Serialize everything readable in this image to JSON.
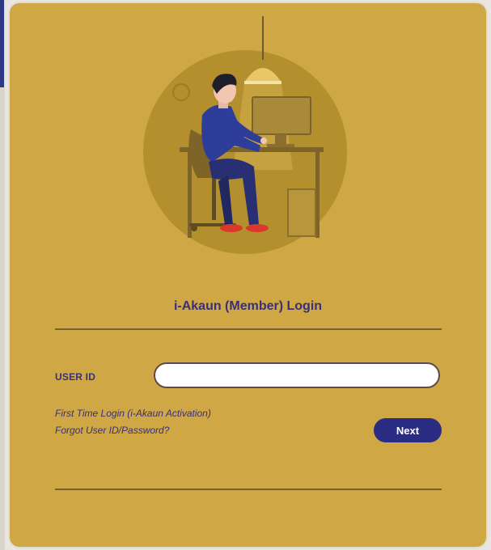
{
  "login": {
    "title": "i-Akaun (Member) Login",
    "user_id_label": "USER ID",
    "user_id_value": "",
    "first_time_link": "First Time Login (i-Akaun Activation)",
    "forgot_link": "Forgot User ID/Password?",
    "next_button": "Next"
  },
  "colors": {
    "card_background": "#cfa744",
    "accent": "#2b2d84",
    "text": "#3a2f7a"
  },
  "icons": {
    "illustration": "person-at-computer-illustration"
  }
}
